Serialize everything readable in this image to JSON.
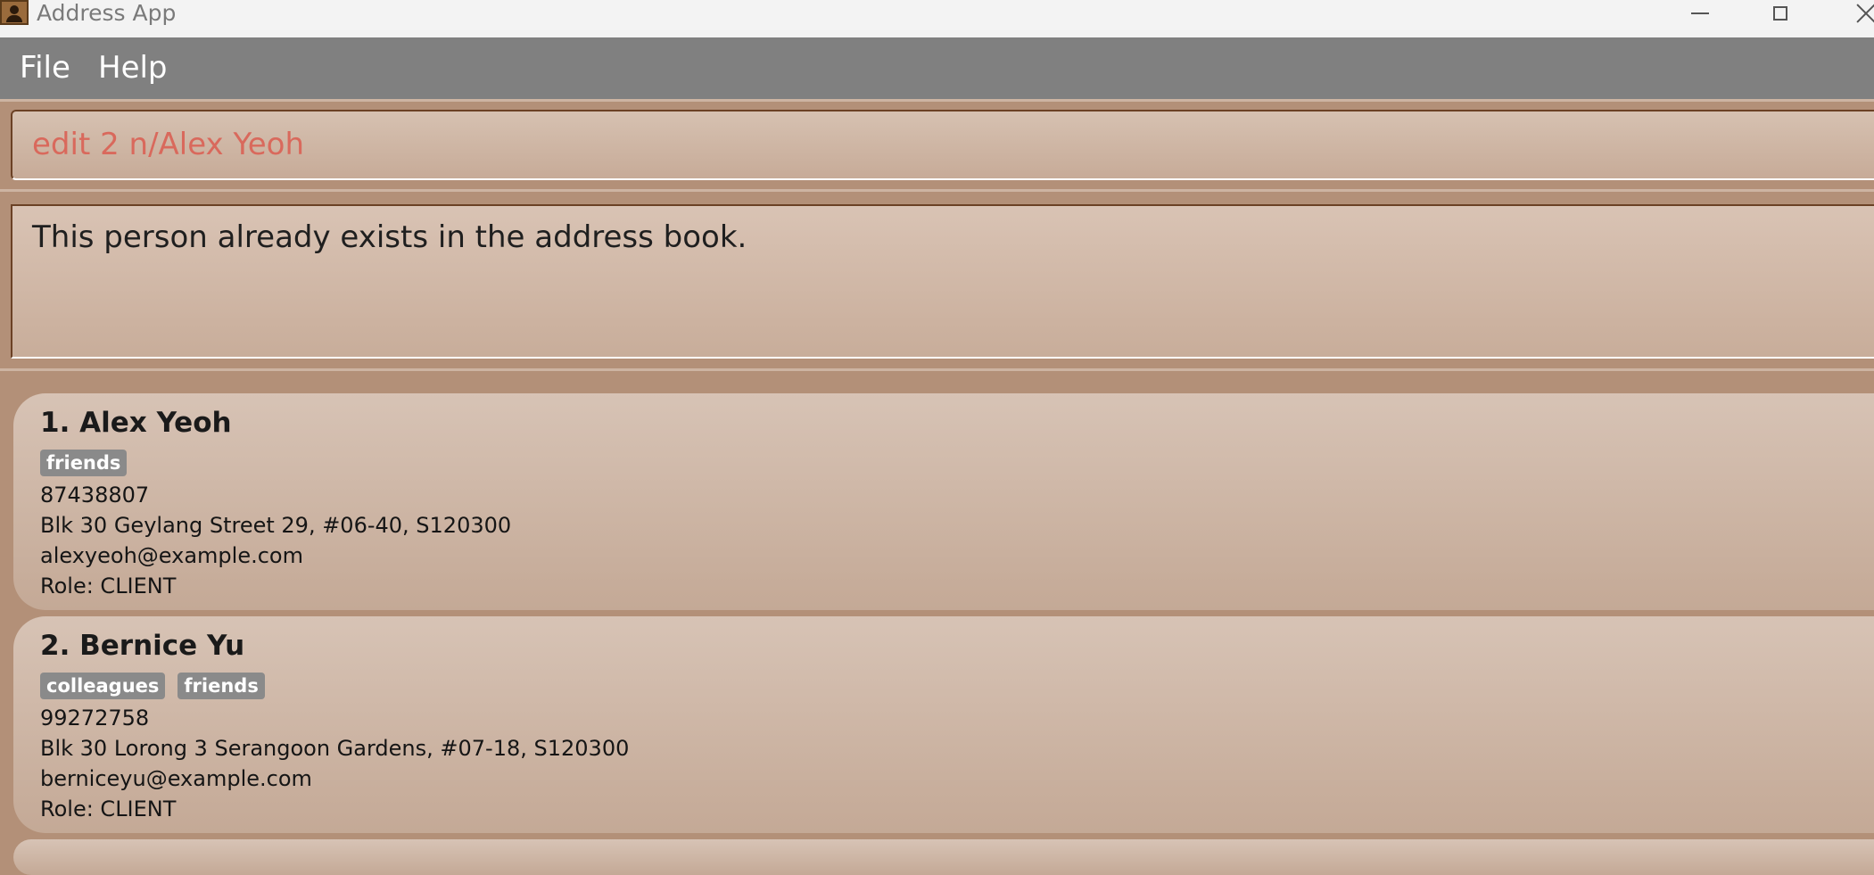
{
  "window": {
    "title": "Address App"
  },
  "menu": {
    "file": "File",
    "help": "Help"
  },
  "command_box": {
    "value": "edit 2 n/Alex Yeoh"
  },
  "result_display": {
    "text": "This person already exists in the address book."
  },
  "persons": [
    {
      "name": "1. Alex Yeoh",
      "tags": [
        "friends"
      ],
      "phone": "87438807",
      "address": "Blk 30 Geylang Street 29, #06-40, S120300",
      "email": "alexyeoh@example.com",
      "role": "Role: CLIENT"
    },
    {
      "name": "2. Bernice Yu",
      "tags": [
        "colleagues",
        "friends"
      ],
      "phone": "99272758",
      "address": "Blk 30 Lorong 3 Serangoon Gardens, #07-18, S120300",
      "email": "berniceyu@example.com",
      "role": "Role: CLIENT"
    }
  ],
  "colors": {
    "menu_bar": "#808080",
    "background": "#b39078",
    "command_text": "#d9695c",
    "tag": "#8a8a8a"
  }
}
